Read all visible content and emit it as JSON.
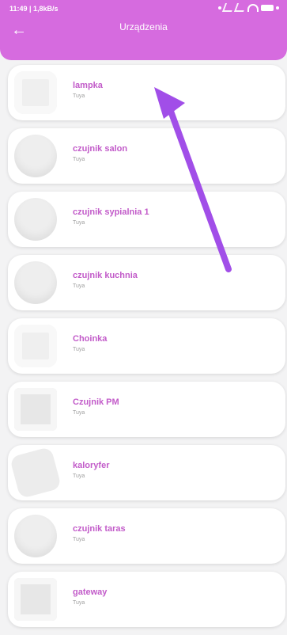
{
  "status_bar": {
    "time": "11:49 | 1,8kB/s"
  },
  "header": {
    "title": "Urządzenia",
    "back_label": "←"
  },
  "devices": [
    {
      "name": "lampka",
      "brand": "Tuya",
      "thumb": "socket"
    },
    {
      "name": "czujnik salon",
      "brand": "Tuya",
      "thumb": "round"
    },
    {
      "name": "czujnik sypialnia 1",
      "brand": "Tuya",
      "thumb": "round"
    },
    {
      "name": "czujnik kuchnia",
      "brand": "Tuya",
      "thumb": "round"
    },
    {
      "name": "Choinka",
      "brand": "Tuya",
      "thumb": "socket"
    },
    {
      "name": "Czujnik PM",
      "brand": "Tuya",
      "thumb": "square"
    },
    {
      "name": "kaloryfer",
      "brand": "Tuya",
      "thumb": "cyl"
    },
    {
      "name": "czujnik taras",
      "brand": "Tuya",
      "thumb": "round"
    },
    {
      "name": "gateway",
      "brand": "Tuya",
      "thumb": "square"
    }
  ],
  "colors": {
    "accent": "#d66bdf",
    "name": "#c25bc9",
    "arrow": "#a14ee8"
  }
}
